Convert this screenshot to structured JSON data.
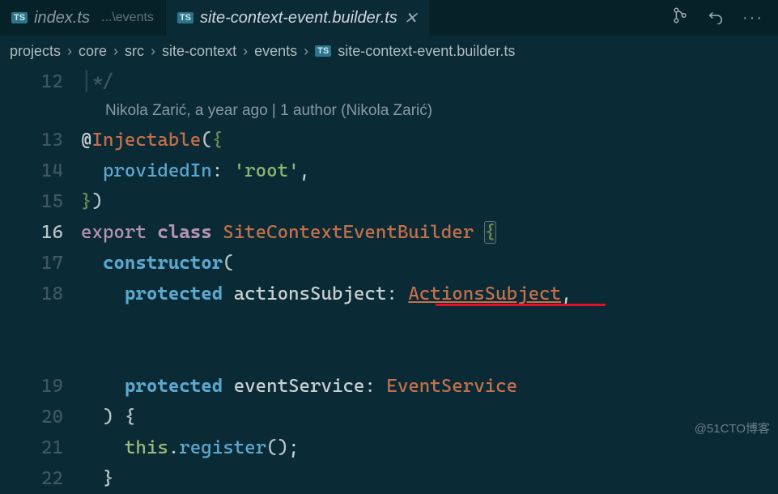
{
  "tabs": [
    {
      "icon": "TS",
      "label": "index.ts",
      "hint": "...\\events",
      "active": false
    },
    {
      "icon": "TS",
      "label": "site-context-event.builder.ts",
      "active": true
    }
  ],
  "breadcrumbs": {
    "segments": [
      "projects",
      "core",
      "src",
      "site-context",
      "events"
    ],
    "fileIcon": "TS",
    "file": "site-context-event.builder.ts"
  },
  "codelens": "Nikola Zarić, a year ago | 1 author (Nikola Zarić)",
  "lines": {
    "l12": "12",
    "l13": "13",
    "l14": "14",
    "l15": "15",
    "l16": "16",
    "l17": "17",
    "l18": "18",
    "l19": "19",
    "l20": "20",
    "l21": "21",
    "l22": "22"
  },
  "tokens": {
    "at": "@",
    "injectable": "Injectable",
    "lparen": "(",
    "rparen": ")",
    "lbrace": "{",
    "rbrace": "}",
    "providedIn": "providedIn",
    "colon": ":",
    "root": "'root'",
    "comma": ",",
    "export": "export",
    "classkw": "class",
    "className": "SiteContextEventBuilder",
    "constructor": "constructor",
    "protected": "protected",
    "actionsSubject": "actionsSubject",
    "ActionsSubjectType": "ActionsSubject",
    "eventService": "eventService",
    "EventServiceType": "EventService",
    "this": "this",
    "dot": ".",
    "register": "register",
    "emptyParens": "()",
    "semi": ";",
    "closeComment": "*/"
  },
  "watermark": "@51CTO博客"
}
